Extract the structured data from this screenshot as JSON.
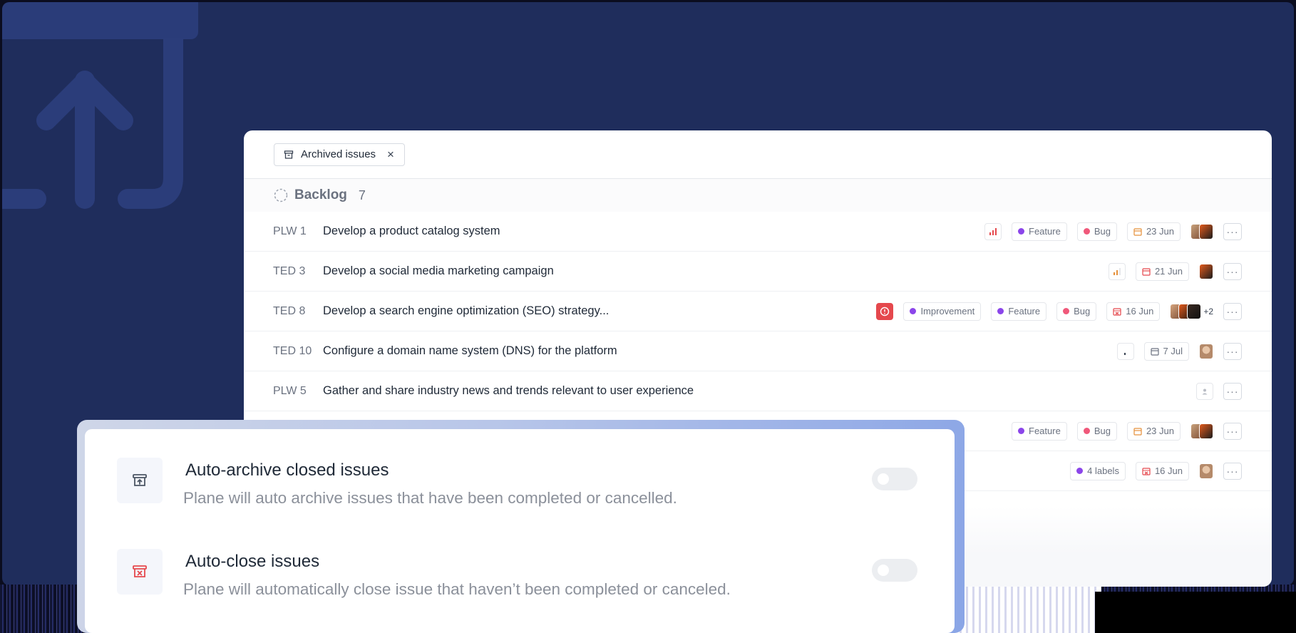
{
  "filter_chip": {
    "label": "Archived issues",
    "close_glyph": "×",
    "icon": "archive-icon"
  },
  "group": {
    "title": "Backlog",
    "count": "7",
    "icon": "backlog-status-icon"
  },
  "rows": [
    {
      "key": "PLW 1",
      "title": "Develop a product catalog system",
      "labels": [
        "Feature",
        "Bug"
      ],
      "date": "23 Jun",
      "avatars": 2,
      "more": "···"
    },
    {
      "key": "TED 3",
      "title": "Develop a social media marketing campaign",
      "labels": [],
      "date": "21 Jun",
      "avatars": 1,
      "more": "···"
    },
    {
      "key": "TED 8",
      "title": "Develop a search engine optimization (SEO) strategy...",
      "labels": [
        "Improvement",
        "Feature",
        "Bug"
      ],
      "date": "16 Jun",
      "avatars": 3,
      "avatar_extra": "+2",
      "more": "···"
    },
    {
      "key": "TED 10",
      "title": "Configure a domain name system (DNS) for the platform",
      "labels": [],
      "date": "7 Jul",
      "avatars": 1,
      "more": "···"
    },
    {
      "key": "PLW 5",
      "title": "Gather and share industry news and trends relevant to user experience",
      "labels": [],
      "date": "",
      "avatars": 0,
      "more": "···"
    },
    {
      "key": "",
      "title": "",
      "labels": [
        "Feature",
        "Bug"
      ],
      "date": "23 Jun",
      "avatars": 2,
      "more": "···"
    },
    {
      "key": "",
      "title": "",
      "labels": [
        "4 labels"
      ],
      "date": "16 Jun",
      "avatars": 1,
      "more": "···"
    }
  ],
  "settings": [
    {
      "title": "Auto-archive closed issues",
      "description": "Plane will auto archive issues that have been completed or cancelled.",
      "icon": "archive-box-icon",
      "enabled": false
    },
    {
      "title": "Auto-close issues",
      "description": "Plane will automatically close issue that haven’t been completed or canceled.",
      "icon": "close-box-icon",
      "enabled": false
    }
  ],
  "colors": {
    "hero_background": "#1f2d5c",
    "label_feature": "#8b45ea",
    "label_bug": "#f0587a",
    "label_improvement": "#8b45ea",
    "urgent_priority": "#e5484d",
    "due_date_orange": "#e5903a",
    "due_date_red": "#e5484d"
  }
}
